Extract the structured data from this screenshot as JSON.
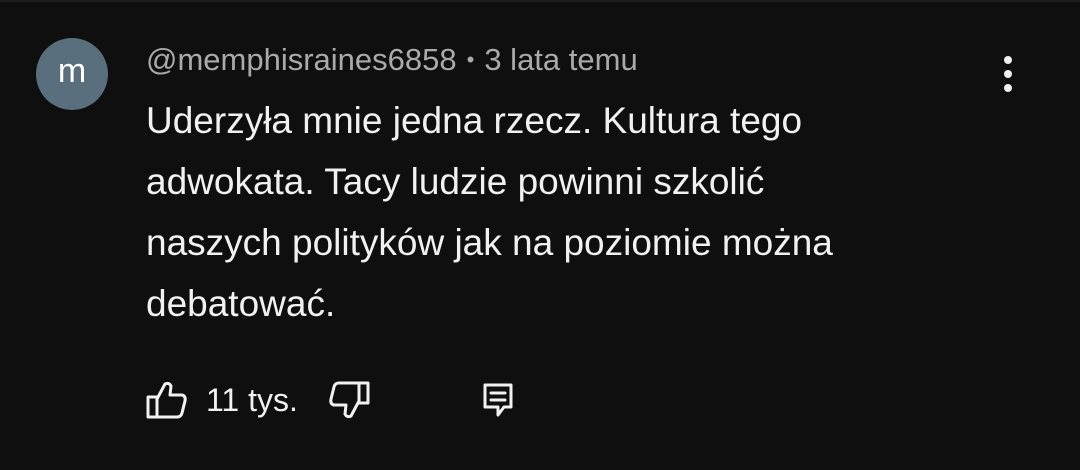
{
  "comment": {
    "avatar_letter": "m",
    "author": "@memphisraines6858",
    "separator": "•",
    "timestamp": "3 lata temu",
    "text_lines": [
      "Uderzyła mnie jedna rzecz. Kultura tego",
      "adwokata. Tacy ludzie powinni szkolić",
      "naszych polityków jak na poziomie można",
      "debatować."
    ],
    "like_count": "11 tys."
  },
  "icons": {
    "menu": "more-vertical-icon",
    "like": "thumbs-up-icon",
    "dislike": "thumbs-down-icon",
    "reply": "reply-comment-icon"
  },
  "colors": {
    "background": "#0f0f0f",
    "avatar": "#5a6f7d",
    "text_primary": "#f1f1f1",
    "text_secondary": "#aaaaaa"
  }
}
